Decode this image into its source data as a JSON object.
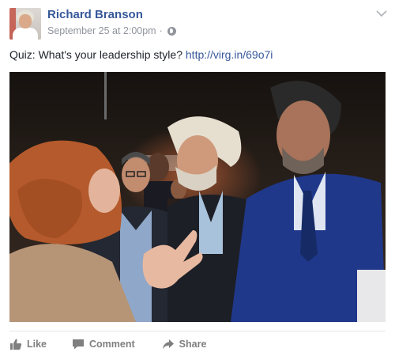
{
  "post": {
    "author": "Richard Branson",
    "timestamp": "September 25 at 2:00pm",
    "separator": "·",
    "privacy_icon": "globe-icon",
    "menu_icon": "chevron-down-icon",
    "text": "Quiz: What's your leadership style?",
    "link": "http://virg.in/69o7i"
  },
  "actions": {
    "like": "Like",
    "comment": "Comment",
    "share": "Share"
  },
  "colors": {
    "author": "#365899",
    "link": "#365899",
    "meta": "#90949c",
    "action": "#7f7f7f"
  }
}
